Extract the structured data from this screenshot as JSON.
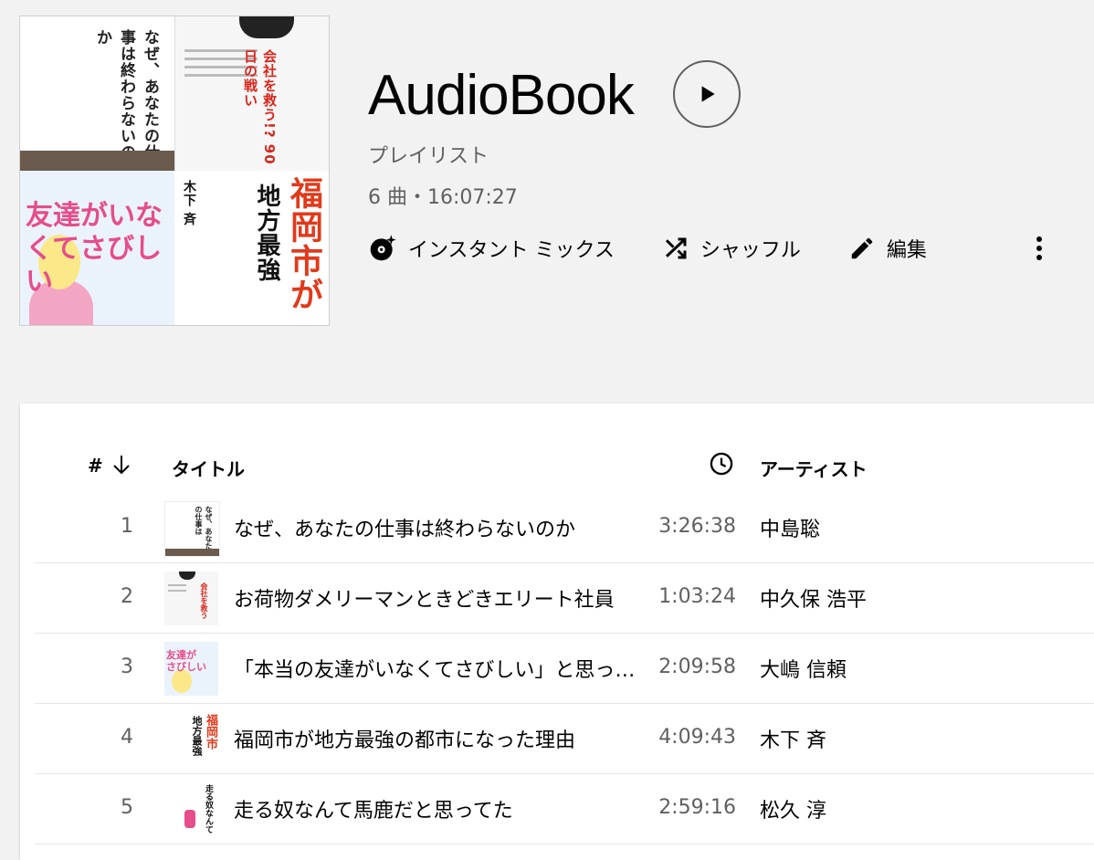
{
  "playlist": {
    "title": "AudioBook",
    "type": "プレイリスト",
    "meta": "6 曲・16:07:27"
  },
  "actions": {
    "mix_label": "インスタント ミックス",
    "shuffle_label": "シャッフル",
    "edit_label": "編集"
  },
  "icons": {
    "play": "play-icon",
    "mix": "instant-mix-icon",
    "shuffle": "shuffle-icon",
    "edit": "pencil-icon",
    "more": "more-vert-icon",
    "sort": "arrow-down-icon",
    "duration": "clock-icon"
  },
  "cover_art": {
    "tile1_text": "なぜ、あなたの仕事は終わらないのか",
    "tile2_text": "会社を救う!? 90日の戦い",
    "tile3_text": "友達がいなくてさびしい",
    "tile4_big": "福岡市が",
    "tile4_mid": "地方最強",
    "tile4_author": "木下 斉"
  },
  "table": {
    "headers": {
      "number": "#",
      "title": "タイトル",
      "artist": "アーティスト"
    },
    "rows": [
      {
        "num": "1",
        "title": "なぜ、あなたの仕事は終わらないのか",
        "duration": "3:26:38",
        "artist": "中島聡"
      },
      {
        "num": "2",
        "title": "お荷物ダメリーマンときどきエリート社員",
        "duration": "1:03:24",
        "artist": "中久保 浩平"
      },
      {
        "num": "3",
        "title": "「本当の友達がいなくてさびしい」と思ったとき読む本",
        "duration": "2:09:58",
        "artist": "大嶋 信頼"
      },
      {
        "num": "4",
        "title": "福岡市が地方最強の都市になった理由",
        "duration": "4:09:43",
        "artist": "木下 斉"
      },
      {
        "num": "5",
        "title": "走る奴なんて馬鹿だと思ってた",
        "duration": "2:59:16",
        "artist": "松久 淳"
      }
    ]
  },
  "colors": {
    "background": "#f2f2f2",
    "text_primary": "#030303",
    "text_secondary": "#606060",
    "accent_red": "#e03a1b"
  }
}
